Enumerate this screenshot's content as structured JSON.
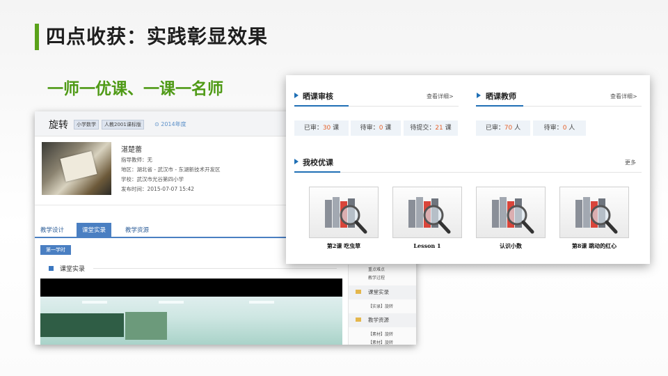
{
  "slide": {
    "title": "四点收获：实践彰显效果",
    "subtitle": "一师一优课、一课一名师",
    "accent_color": "#5aa21a"
  },
  "lesson_page": {
    "lesson_title": "旋转",
    "tags": [
      "小学数学",
      "人教2001课标版"
    ],
    "year": "2014年度",
    "teacher_name": "湛楚蕾",
    "info": [
      "指导教师：无",
      "地区：湖北省 - 武汉市 - 东湖新技术开发区",
      "学校：武汉市光谷第四小学",
      "发布时间：2015-07-07 15:42"
    ],
    "tabs": [
      "教学设计",
      "课堂实录",
      "教学资源"
    ],
    "active_tab": "课堂实录",
    "term_label": "第一学时",
    "section_title": "课堂实录",
    "side_panel": {
      "top_items": [
        "重点难点",
        "教学过程"
      ],
      "folders": [
        {
          "label": "课堂实录",
          "items": [
            "【实录】旋转"
          ]
        },
        {
          "label": "教学资源",
          "items": [
            "【素材】旋转",
            "【素材】旋转"
          ]
        }
      ]
    }
  },
  "school_page": {
    "review": {
      "title": "晒课审核",
      "link": "查看详细>",
      "stats": [
        {
          "label": "已审：",
          "value": "30",
          "unit": "课"
        },
        {
          "label": "待审：",
          "value": "0",
          "unit": "课"
        },
        {
          "label": "待提交：",
          "value": "21",
          "unit": "课"
        }
      ]
    },
    "teachers": {
      "title": "晒课教师",
      "link": "查看详细>",
      "stats": [
        {
          "label": "已审：",
          "value": "70",
          "unit": "人"
        },
        {
          "label": "待审：",
          "value": "0",
          "unit": "人"
        }
      ]
    },
    "courses": {
      "title": "我校优课",
      "more": "更多",
      "items": [
        {
          "name": "第2课 吃虫草"
        },
        {
          "name": "Lesson 1"
        },
        {
          "name": "认识小数"
        },
        {
          "name": "第8课 跳动的红心"
        }
      ]
    }
  }
}
